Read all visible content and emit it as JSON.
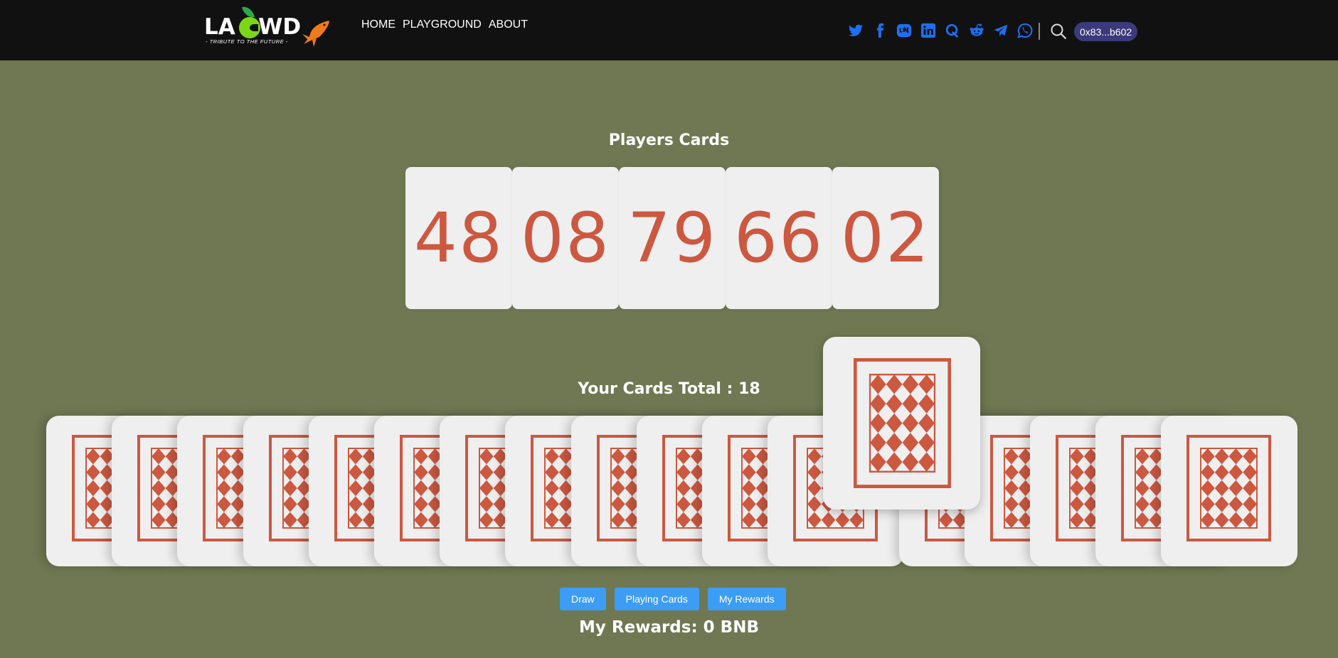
{
  "header": {
    "logo_text": "LA WD",
    "logo_tagline": "- TRIBUTE TO THE FUTURE -",
    "nav": [
      "HOME",
      "PLAYGROUND",
      "ABOUT"
    ],
    "socials": [
      "twitter-icon",
      "facebook-icon",
      "line-icon",
      "linkedin-icon",
      "quora-icon",
      "reddit-icon",
      "telegram-icon",
      "whatsapp-icon"
    ],
    "social_color": "#1e6ff1",
    "wallet": "0x83...b602"
  },
  "players": {
    "title": "Players Cards",
    "cards": [
      "48",
      "08",
      "79",
      "66",
      "02"
    ]
  },
  "hand": {
    "title": "Your Cards Total : 18",
    "count": 18,
    "lifted_index": 12
  },
  "buttons": {
    "draw": "Draw",
    "playing_cards": "Playing Cards",
    "my_rewards": "My Rewards"
  },
  "rewards": {
    "text": "My Rewards: 0 BNB"
  },
  "colors": {
    "background": "#6f7852",
    "header": "#111111",
    "card": "#efefef",
    "card_accent": "#cc5840",
    "button": "#3d9df5",
    "wallet": "#3b3a7a"
  }
}
